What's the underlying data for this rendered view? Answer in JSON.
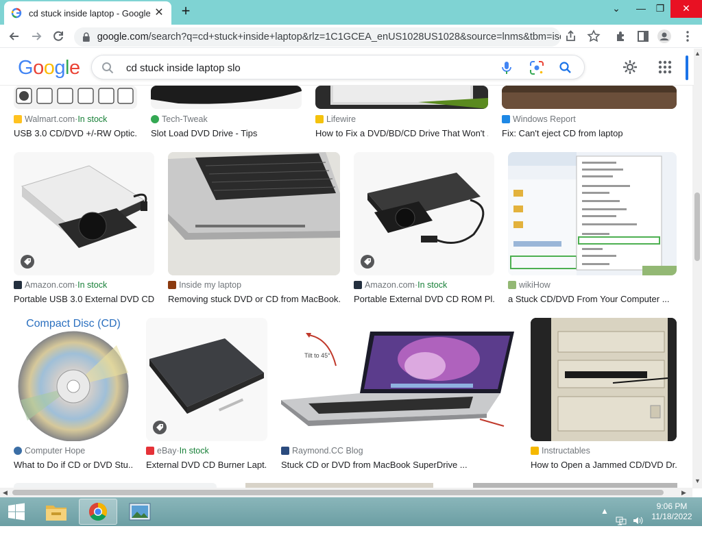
{
  "browser": {
    "tab_title": "cd stuck inside laptop - Google S",
    "new_tab": "+",
    "url_host": "google.com",
    "url_path": "/search?q=cd+stuck+inside+laptop&rlz=1C1GCEA_enUS1028US1028&source=lnms&tbm=isc...",
    "window_controls": [
      "minimize",
      "restore",
      "close"
    ]
  },
  "google": {
    "logo": "Google",
    "logo_colors": [
      "#4285F4",
      "#EA4335",
      "#FBBC05",
      "#4285F4",
      "#34A853",
      "#EA4335"
    ],
    "search_value": "cd stuck inside laptop slo"
  },
  "results_row0": [
    {
      "source": "Walmart.com",
      "stock": "In stock",
      "title": "USB 3.0 CD/DVD +/-RW Optic...",
      "fav_color": "#ffc220"
    },
    {
      "source": "Tech-Tweak",
      "stock": "",
      "title": "Slot Load DVD Drive - Tips",
      "fav_color": "#34a853"
    },
    {
      "source": "Lifewire",
      "stock": "",
      "title": "How to Fix a DVD/BD/CD Drive That Won't ...",
      "fav_color": "#f4c20d"
    },
    {
      "source": "Windows Report",
      "stock": "",
      "title": "Fix: Can't eject CD from laptop",
      "fav_color": "#1e88e5"
    }
  ],
  "results_row1": [
    {
      "source": "Amazon.com",
      "stock": "In stock",
      "title": "Portable USB 3.0 External DVD CD...",
      "fav_color": "#232f3e"
    },
    {
      "source": "Inside my laptop",
      "stock": "",
      "title": "Removing stuck DVD or CD from MacBook...",
      "fav_color": "#8b3a0f"
    },
    {
      "source": "Amazon.com",
      "stock": "In stock",
      "title": "Portable External DVD CD ROM Pl...",
      "fav_color": "#232f3e"
    },
    {
      "source": "wikiHow",
      "stock": "",
      "title": "a Stuck CD/DVD From Your Computer ...",
      "fav_color": "#93b874"
    }
  ],
  "results_row2": [
    {
      "source": "Computer Hope",
      "stock": "",
      "title": "What to Do if CD or DVD Stu...",
      "fav_color": "#3b6ea5",
      "thumb_text": "Compact Disc (CD)"
    },
    {
      "source": "eBay",
      "stock": "In stock",
      "title": "External DVD CD Burner Lapt...",
      "fav_color": "#e53238"
    },
    {
      "source": "Raymond.CC Blog",
      "stock": "",
      "title": "Stuck CD or DVD from MacBook SuperDrive ...",
      "fav_color": "#2b4b7e",
      "thumb_text": "Tilt to 45°"
    },
    {
      "source": "Instructables",
      "stock": "",
      "title": "How to Open a Jammed CD/DVD Dr...",
      "fav_color": "#f5b800"
    }
  ],
  "separator": " · ",
  "taskbar": {
    "time": "9:06 PM",
    "date": "11/18/2022"
  }
}
